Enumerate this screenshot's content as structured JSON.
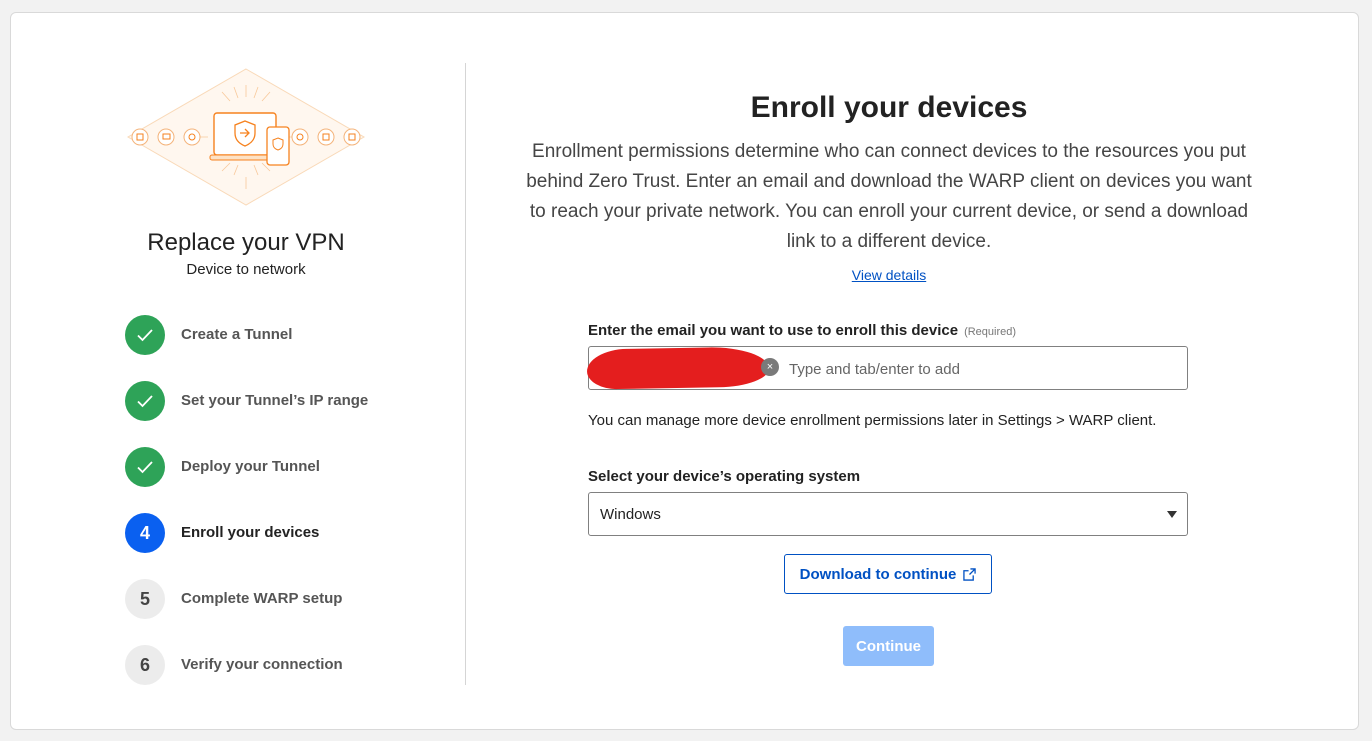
{
  "sidebar": {
    "title": "Replace your VPN",
    "subtitle": "Device to network",
    "steps": [
      {
        "number": "1",
        "label": "Create a Tunnel",
        "status": "complete",
        "icon": "check-icon"
      },
      {
        "number": "2",
        "label": "Set your Tunnel’s IP range",
        "status": "complete",
        "icon": "check-icon"
      },
      {
        "number": "3",
        "label": "Deploy your Tunnel",
        "status": "complete",
        "icon": "check-icon"
      },
      {
        "number": "4",
        "label": "Enroll your devices",
        "status": "active"
      },
      {
        "number": "5",
        "label": "Complete WARP setup",
        "status": "pending"
      },
      {
        "number": "6",
        "label": "Verify your connection",
        "status": "pending"
      }
    ]
  },
  "main": {
    "title": "Enroll your devices",
    "description": "Enrollment permissions determine who can connect devices to the resources you put behind Zero Trust. Enter an email and download the WARP client on devices you want to reach your private network. You can enroll your current device, or send a download link to a different device.",
    "view_details": "View details",
    "email": {
      "label": "Enter the email you want to use to enroll this device",
      "required": "(Required)",
      "placeholder": "Type and tab/enter to add",
      "chip_redacted": true
    },
    "hint": "You can manage more device enrollment permissions later in Settings > WARP client.",
    "os": {
      "label": "Select your device’s operating system",
      "selected": "Windows"
    },
    "download_button": "Download to continue",
    "continue_button": "Continue"
  },
  "colors": {
    "complete": "#2ea358",
    "active": "#0a60f0",
    "link": "#0051c3",
    "continue_disabled": "#8fbdfb",
    "redaction": "#e41e1e",
    "illustration_accent": "#f6821f"
  }
}
